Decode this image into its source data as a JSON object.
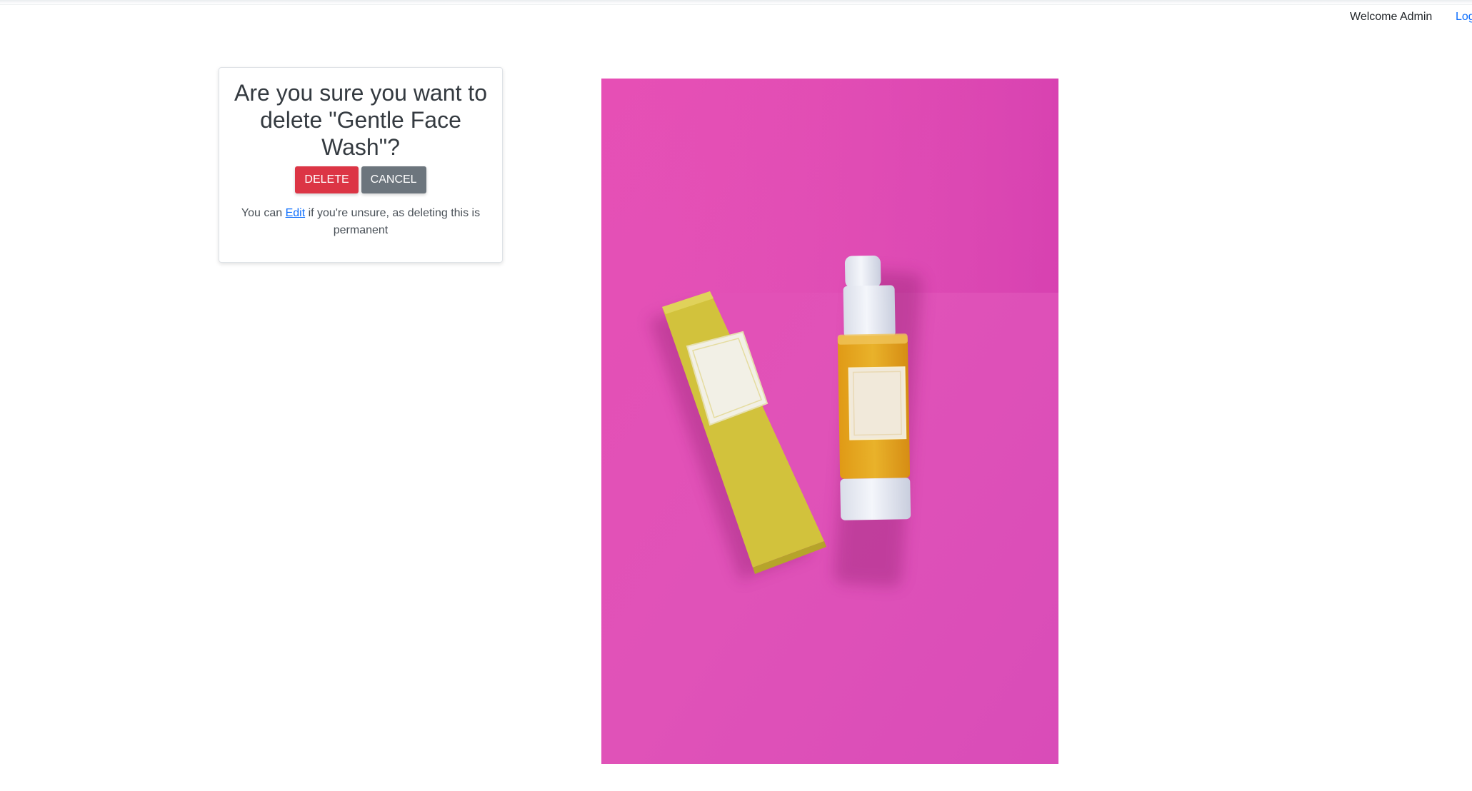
{
  "header": {
    "welcome_text": "Welcome Admin",
    "logout_label": "Log"
  },
  "dialog": {
    "title": "Are you sure you want to delete \"Gentle Face Wash\"?",
    "delete_label": "DELETE",
    "cancel_label": "CANCEL",
    "note_before": "You can ",
    "note_link": "Edit",
    "note_after": " if you're unsure, as deleting this is permanent"
  },
  "product_image": {
    "alt": "Gentle Face Wash",
    "background_color": "#e24fb4",
    "box_color": "#d4c33c",
    "liquid_color": "#e2a51a"
  },
  "colors": {
    "danger": "#dc3545",
    "secondary": "#6c757d",
    "link": "#0d6efd"
  }
}
